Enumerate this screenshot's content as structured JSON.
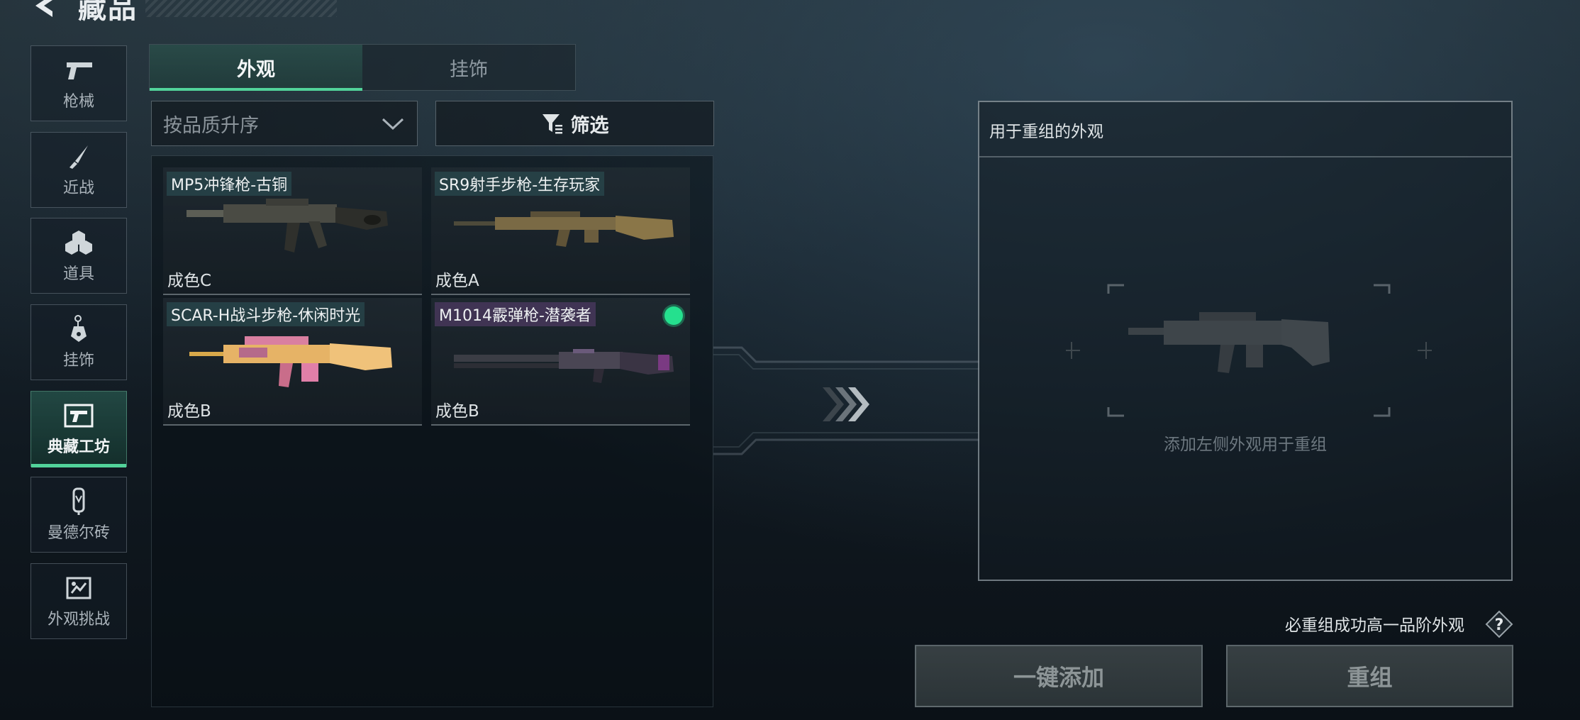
{
  "header": {
    "title": "藏品"
  },
  "nav": {
    "items": [
      {
        "label": "枪械",
        "icon": "pistol-icon"
      },
      {
        "label": "近战",
        "icon": "knife-icon"
      },
      {
        "label": "道具",
        "icon": "grenades-icon"
      },
      {
        "label": "挂饰",
        "icon": "charm-icon"
      },
      {
        "label": "典藏工坊",
        "icon": "workshop-icon",
        "active": true
      },
      {
        "label": "曼德尔砖",
        "icon": "mandel-brick-icon"
      },
      {
        "label": "外观挑战",
        "icon": "challenge-icon"
      }
    ]
  },
  "tabs": [
    {
      "label": "外观",
      "active": true
    },
    {
      "label": "挂饰",
      "active": false
    }
  ],
  "sort": {
    "value": "按品质升序"
  },
  "filter": {
    "label": "筛选"
  },
  "items": [
    {
      "name": "MP5冲锋枪-古铜",
      "grade": "成色C",
      "selected": false
    },
    {
      "name": "SR9射手步枪-生存玩家",
      "grade": "成色A",
      "selected": false
    },
    {
      "name": "SCAR-H战斗步枪-休闲时光",
      "grade": "成色B",
      "selected": false
    },
    {
      "name": "M1014霰弹枪-潜袭者",
      "grade": "成色B",
      "selected": true
    }
  ],
  "recombine": {
    "title": "用于重组的外观",
    "placeholder": "添加左侧外观用于重组"
  },
  "hint": "必重组成功高一品阶外观",
  "buttons": {
    "add_all": "一键添加",
    "recombine": "重组"
  },
  "colors": {
    "accent": "#52d39a",
    "selected_dot": "#25e08e"
  }
}
